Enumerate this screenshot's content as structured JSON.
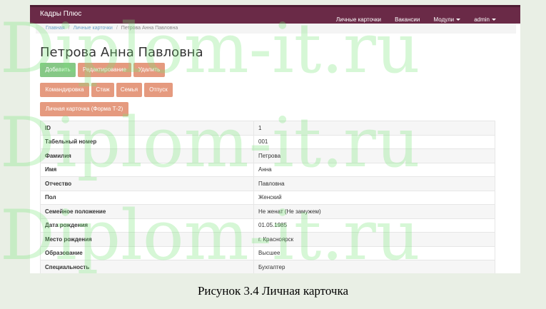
{
  "app": {
    "brand": "Кадры Плюс"
  },
  "nav": {
    "items": [
      "Личные карточки",
      "Вакансии"
    ],
    "modules_label": "Модули",
    "user_label": "admin"
  },
  "breadcrumb": {
    "home": "Главная",
    "cards": "Личные карточки",
    "current": "Петрова Анна Павловна"
  },
  "page": {
    "title": "Петрова Анна Павловна"
  },
  "actions": {
    "add": "Добавить",
    "edit": "Редактирование",
    "delete": "Удалить",
    "trip": "Командировка",
    "experience": "Стаж",
    "family": "Семья",
    "vacation": "Отпуск",
    "card_t2": "Личная карточка (Форма Т-2)"
  },
  "details": {
    "rows": [
      {
        "label": "ID",
        "value": "1"
      },
      {
        "label": "Табельный номер",
        "value": "001"
      },
      {
        "label": "Фамилия",
        "value": "Петрова"
      },
      {
        "label": "Имя",
        "value": "Анна"
      },
      {
        "label": "Отчество",
        "value": "Павловна"
      },
      {
        "label": "Пол",
        "value": "Женский"
      },
      {
        "label": "Семейное положение",
        "value": "Не женат (Не замужем)"
      },
      {
        "label": "Дата рождения",
        "value": "01.05.1985"
      },
      {
        "label": "Место рождения",
        "value": "г. Красноярск"
      },
      {
        "label": "Образование",
        "value": "Высшее"
      },
      {
        "label": "Специальность",
        "value": "Бухгалтер"
      }
    ]
  },
  "watermark": {
    "text": "Diplom-it.ru"
  },
  "caption": {
    "text": "Рисунок 3.4 Личная карточка"
  },
  "colors": {
    "navbar": "#6a2a47",
    "btn_green": "#86c886",
    "btn_salmon": "#e59a7f"
  }
}
